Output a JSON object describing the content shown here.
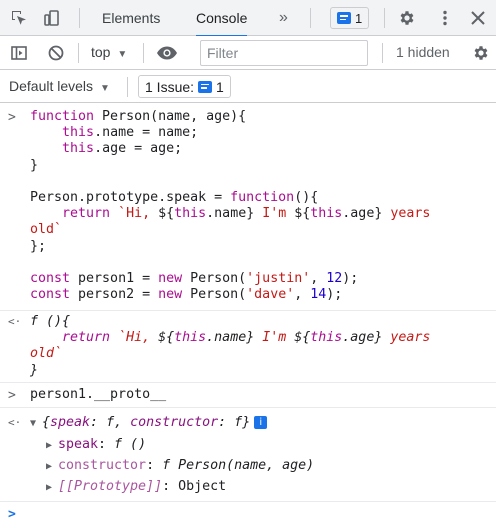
{
  "tabs": [
    {
      "label": "Elements"
    },
    {
      "label": "Console"
    }
  ],
  "tabs_more": "»",
  "issues_badge_count": "1",
  "toolbar": {
    "context": "top",
    "filter_placeholder": "Filter",
    "hidden_label": "1 hidden"
  },
  "levels": {
    "default_levels": "Default levels",
    "issue_label": "1 Issue:",
    "issue_count": "1"
  },
  "console": {
    "input1_lines": [
      "function Person(name, age){",
      "    this.name = name;",
      "    this.age = age;",
      "}",
      "",
      "Person.prototype.speak = function(){",
      "    return `Hi, ${this.name} I'm ${this.age} years",
      "old`",
      "};",
      "",
      "const person1 = new Person('justin', 12);",
      "const person2 = new Person('dave', 14);"
    ],
    "output1_lines": [
      "f (){",
      "    return `Hi, ${this.name} I'm ${this.age} years",
      "old`",
      "}"
    ],
    "input2": "person1.__proto__",
    "output2": {
      "summary_open": "{",
      "summary_key1": "speak",
      "summary_val1": "f",
      "summary_key2": "constructor",
      "summary_val2": "f",
      "summary_close": "}",
      "info_icon": "i",
      "props": [
        {
          "key": "speak",
          "sep": ": ",
          "value": "f ()"
        },
        {
          "key": "constructor",
          "sep": ": ",
          "value": "f Person(name, age)"
        },
        {
          "key": "[[Prototype]]",
          "sep": ": ",
          "value": "Object"
        }
      ]
    }
  },
  "colors": {
    "accent": "#1a73e8",
    "keyword": "#aa0d91",
    "string": "#c41a16",
    "number": "#1c00cf",
    "property": "#881280"
  },
  "icons": [
    "inspect-element-icon",
    "device-toolbar-icon",
    "message-icon",
    "settings-gear-icon",
    "more-vertical-icon",
    "close-icon",
    "sidebar-toggle-icon",
    "clear-console-icon",
    "eye-icon",
    "dropdown-arrow-icon",
    "input-prompt-icon",
    "output-return-icon"
  ]
}
